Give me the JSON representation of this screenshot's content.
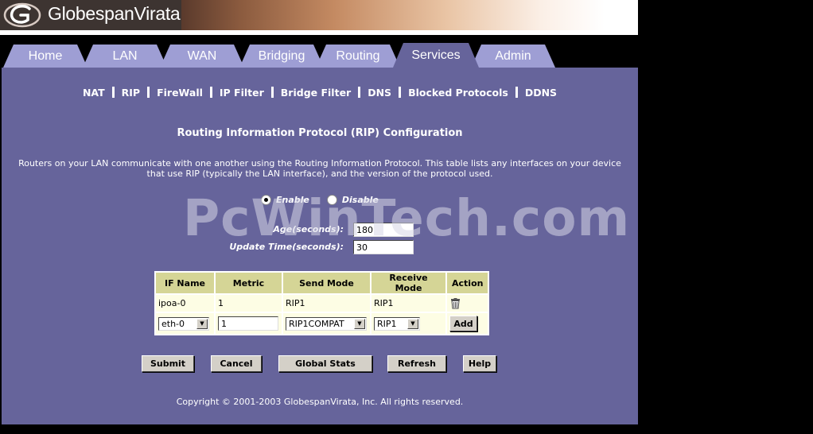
{
  "brand": {
    "name": "GlobespanVirata"
  },
  "tabs": [
    {
      "label": "Home",
      "active": false
    },
    {
      "label": "LAN",
      "active": false
    },
    {
      "label": "WAN",
      "active": false
    },
    {
      "label": "Bridging",
      "active": false
    },
    {
      "label": "Routing",
      "active": false
    },
    {
      "label": "Services",
      "active": true
    },
    {
      "label": "Admin",
      "active": false
    }
  ],
  "subnav": [
    "NAT",
    "RIP",
    "FireWall",
    "IP Filter",
    "Bridge Filter",
    "DNS",
    "Blocked Protocols",
    "DDNS"
  ],
  "page": {
    "title": "Routing Information Protocol (RIP) Configuration",
    "description": "Routers on your LAN communicate with one another using the Routing Information Protocol. This table lists any interfaces on your device that use RIP (typically the LAN interface), and the version of the protocol used."
  },
  "rip": {
    "enable_label": "Enable",
    "disable_label": "Disable",
    "selected": "Enable",
    "age_label": "Age(seconds):",
    "age_value": "180",
    "update_label": "Update Time(seconds):",
    "update_value": "30"
  },
  "table": {
    "headers": [
      "IF Name",
      "Metric",
      "Send Mode",
      "Receive Mode",
      "Action"
    ],
    "rows": [
      {
        "if_name": "ipoa-0",
        "metric": "1",
        "send_mode": "RIP1",
        "receive_mode": "RIP1",
        "action_icon": "trash-icon"
      }
    ],
    "new_row": {
      "if_name": "eth-0",
      "metric": "1",
      "send_mode": "RIP1COMPAT",
      "receive_mode": "RIP1",
      "add_label": "Add"
    }
  },
  "buttons": {
    "submit": "Submit",
    "cancel": "Cancel",
    "global_stats": "Global Stats",
    "refresh": "Refresh",
    "help": "Help"
  },
  "footer": {
    "copyright": "Copyright © 2001-2003 GlobespanVirata, Inc. All rights reserved."
  },
  "watermark": "PcWinTech.com",
  "colors": {
    "panel": "#66649b",
    "tab": "#9e9ed4",
    "table_header": "#d5d596",
    "table_cell": "#fdfde4"
  }
}
